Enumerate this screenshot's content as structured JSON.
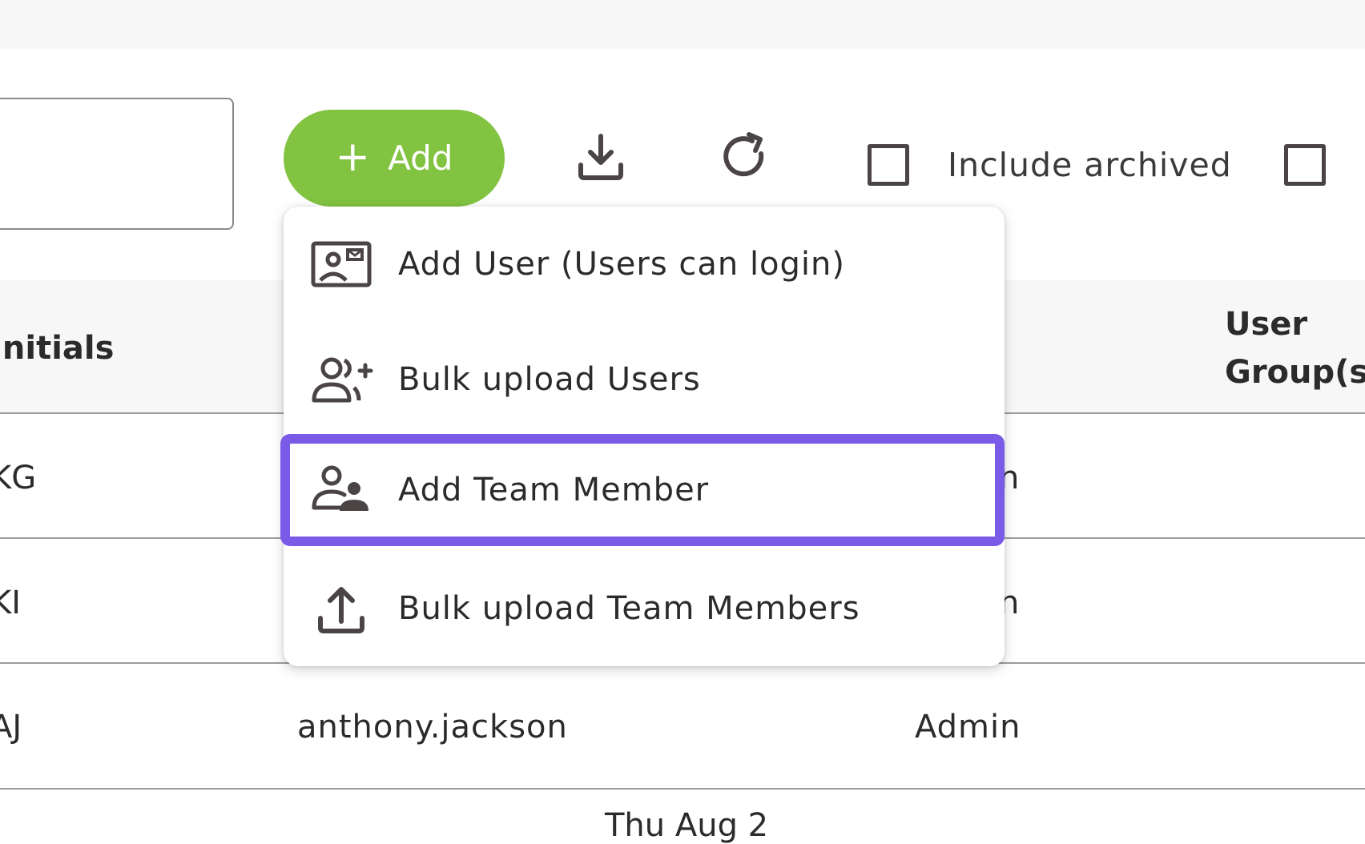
{
  "toolbar": {
    "add_label": "Add",
    "plus_glyph": "+",
    "download_icon": "download-icon",
    "refresh_icon": "refresh-icon",
    "include_archived_label": "Include archived"
  },
  "add_menu": {
    "items": [
      {
        "label": "Add User (Users can login)",
        "icon": "user-card-icon"
      },
      {
        "label": "Bulk upload Users",
        "icon": "users-add-icon"
      },
      {
        "label": "Add Team Member",
        "icon": "team-member-icon",
        "highlighted": true
      },
      {
        "label": "Bulk upload Team Members",
        "icon": "upload-icon"
      }
    ]
  },
  "table": {
    "headers": {
      "initials": "Initials",
      "user_groups_line1": "User",
      "user_groups_line2": "Group(s)"
    },
    "rows": [
      {
        "initials": "KG",
        "role_fragment": "n"
      },
      {
        "initials": "KI",
        "role_fragment": "n"
      },
      {
        "initials": "AJ",
        "email": "anthony.jackson@",
        "role": "Admin"
      }
    ],
    "footer_fragment": "Thu Aug 2"
  },
  "colors": {
    "accent_green": "#82c341",
    "highlight_purple": "#7a5be8"
  }
}
